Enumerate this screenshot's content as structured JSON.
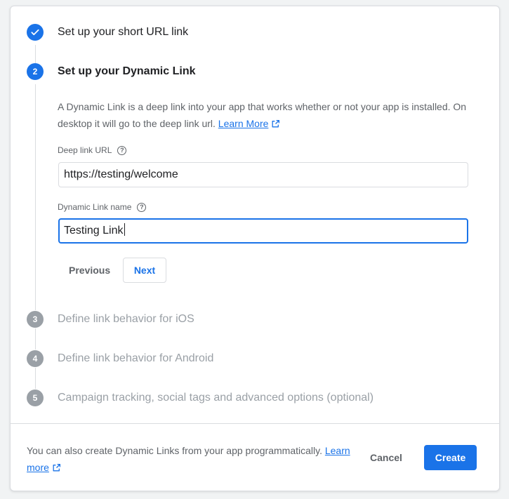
{
  "steps": [
    {
      "number": "1",
      "title": "Set up your short URL link",
      "state": "done"
    },
    {
      "number": "2",
      "title": "Set up your Dynamic Link",
      "state": "active"
    },
    {
      "number": "3",
      "title": "Define link behavior for iOS",
      "state": "todo"
    },
    {
      "number": "4",
      "title": "Define link behavior for Android",
      "state": "todo"
    },
    {
      "number": "5",
      "title": "Campaign tracking, social tags and advanced options (optional)",
      "state": "todo"
    }
  ],
  "step2": {
    "description": "A Dynamic Link is a deep link into your app that works whether or not your app is installed. On desktop it will go to the deep link url.",
    "learn_more": "Learn More",
    "deep_link_label": "Deep link URL",
    "deep_link_value": "https://testing/welcome",
    "link_name_label": "Dynamic Link name",
    "link_name_value": "Testing Link",
    "previous_label": "Previous",
    "next_label": "Next"
  },
  "footer": {
    "text": "You can also create Dynamic Links from your app programmatically.",
    "learn_more": "Learn more",
    "cancel_label": "Cancel",
    "create_label": "Create"
  },
  "icons": {
    "done": "check-icon",
    "external": "external-link-icon",
    "help": "help-icon"
  },
  "colors": {
    "accent": "#1a73e8",
    "disabled": "#9aa0a6"
  }
}
